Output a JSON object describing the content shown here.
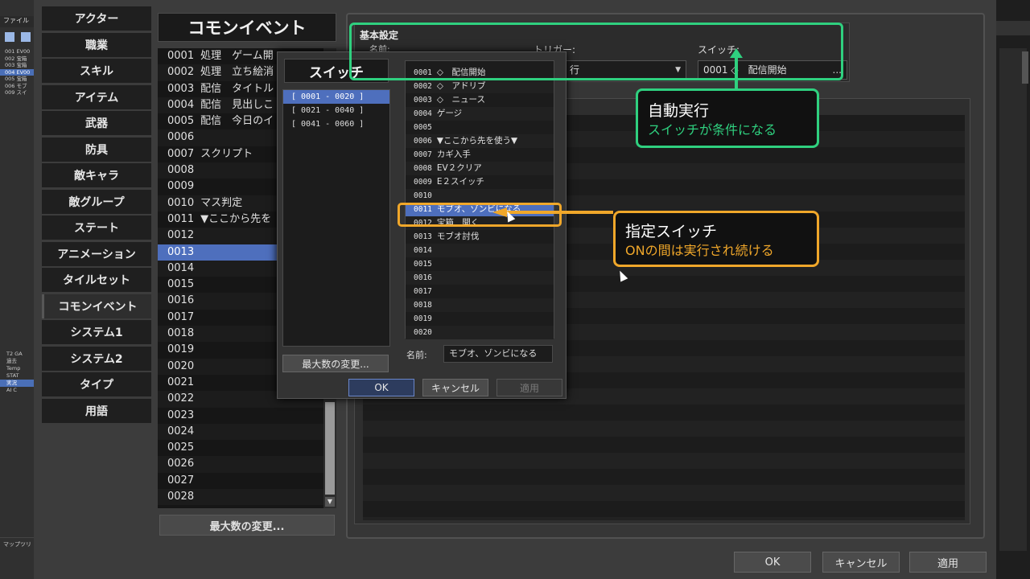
{
  "bg_left": {
    "menu": "ファイル",
    "map_items": [
      "001 EV00",
      "002 宝箱",
      "003 宝箱",
      "004 EV00",
      "005 宝箱",
      "006 モブ",
      "009 スイ"
    ],
    "tree_items": [
      "T2 GA",
      "過去",
      "Temp",
      "STAT",
      "実況",
      "AI C"
    ],
    "footer": "マップツリ"
  },
  "categories": [
    "アクター",
    "職業",
    "スキル",
    "アイテム",
    "武器",
    "防具",
    "敵キャラ",
    "敵グループ",
    "ステート",
    "アニメーション",
    "タイルセット",
    "コモンイベント",
    "システム1",
    "システム2",
    "タイプ",
    "用語"
  ],
  "common_events": {
    "title": "コモンイベント",
    "rows": [
      {
        "no": "0001",
        "name": "処理　ゲーム開"
      },
      {
        "no": "0002",
        "name": "処理　立ち絵消"
      },
      {
        "no": "0003",
        "name": "配信　タイトル"
      },
      {
        "no": "0004",
        "name": "配信　見出しこ"
      },
      {
        "no": "0005",
        "name": "配信　今日のイ"
      },
      {
        "no": "0006",
        "name": ""
      },
      {
        "no": "0007",
        "name": "スクリプト"
      },
      {
        "no": "0008",
        "name": ""
      },
      {
        "no": "0009",
        "name": ""
      },
      {
        "no": "0010",
        "name": "マス判定"
      },
      {
        "no": "0011",
        "name": "▼ここから先を"
      },
      {
        "no": "0012",
        "name": ""
      },
      {
        "no": "0013",
        "name": ""
      },
      {
        "no": "0014",
        "name": ""
      },
      {
        "no": "0015",
        "name": ""
      },
      {
        "no": "0016",
        "name": ""
      },
      {
        "no": "0017",
        "name": ""
      },
      {
        "no": "0018",
        "name": ""
      },
      {
        "no": "0019",
        "name": ""
      },
      {
        "no": "0020",
        "name": ""
      },
      {
        "no": "0021",
        "name": ""
      },
      {
        "no": "0022",
        "name": ""
      },
      {
        "no": "0023",
        "name": ""
      },
      {
        "no": "0024",
        "name": ""
      },
      {
        "no": "0025",
        "name": ""
      },
      {
        "no": "0026",
        "name": ""
      },
      {
        "no": "0027",
        "name": ""
      },
      {
        "no": "0028",
        "name": ""
      }
    ],
    "selected": "0013",
    "max_button": "最大数の変更..."
  },
  "basic_settings": {
    "title": "基本設定",
    "name_label": "名前:",
    "trigger_label": "トリガー:",
    "trigger_value": "行",
    "switch_label": "スイッチ:",
    "switch_value": "0001 ◇　配信開始",
    "switch_dots": "..."
  },
  "footer_buttons": {
    "ok": "OK",
    "cancel": "キャンセル",
    "apply": "適用"
  },
  "switch_dialog": {
    "title": "スイッチ",
    "groups": [
      "[ 0001 - 0020 ]",
      "[ 0021 - 0040 ]",
      "[ 0041 - 0060 ]"
    ],
    "max_button": "最大数の変更...",
    "switches": [
      {
        "no": "0001",
        "name": "◇　配信開始"
      },
      {
        "no": "0002",
        "name": "◇　アドリブ"
      },
      {
        "no": "0003",
        "name": "◇　ニュース"
      },
      {
        "no": "0004",
        "name": "ゲージ"
      },
      {
        "no": "0005",
        "name": ""
      },
      {
        "no": "0006",
        "name": "▼ここから先を使う▼"
      },
      {
        "no": "0007",
        "name": "カギ入手"
      },
      {
        "no": "0008",
        "name": "EV２クリア"
      },
      {
        "no": "0009",
        "name": "E２スイッチ"
      },
      {
        "no": "0010",
        "name": ""
      },
      {
        "no": "0011",
        "name": "モブオ、ゾンビになる"
      },
      {
        "no": "0012",
        "name": "宝箱　開く"
      },
      {
        "no": "0013",
        "name": "モブオ討伐"
      },
      {
        "no": "0014",
        "name": ""
      },
      {
        "no": "0015",
        "name": ""
      },
      {
        "no": "0016",
        "name": ""
      },
      {
        "no": "0017",
        "name": ""
      },
      {
        "no": "0018",
        "name": ""
      },
      {
        "no": "0019",
        "name": ""
      },
      {
        "no": "0020",
        "name": ""
      }
    ],
    "selected": "0011",
    "name_label": "名前:",
    "name_value": "モブオ、ゾンビになる",
    "ok": "OK",
    "cancel": "キャンセル",
    "apply": "適用"
  },
  "annotations": {
    "green_title": "自動実行",
    "green_sub": "スイッチが条件になる",
    "orange_title": "指定スイッチ",
    "orange_sub": "ONの間は実行され続ける",
    "green_color": "#2fd07f",
    "orange_color": "#f0a72a"
  },
  "colors": {
    "selection": "#4e6fbd"
  }
}
